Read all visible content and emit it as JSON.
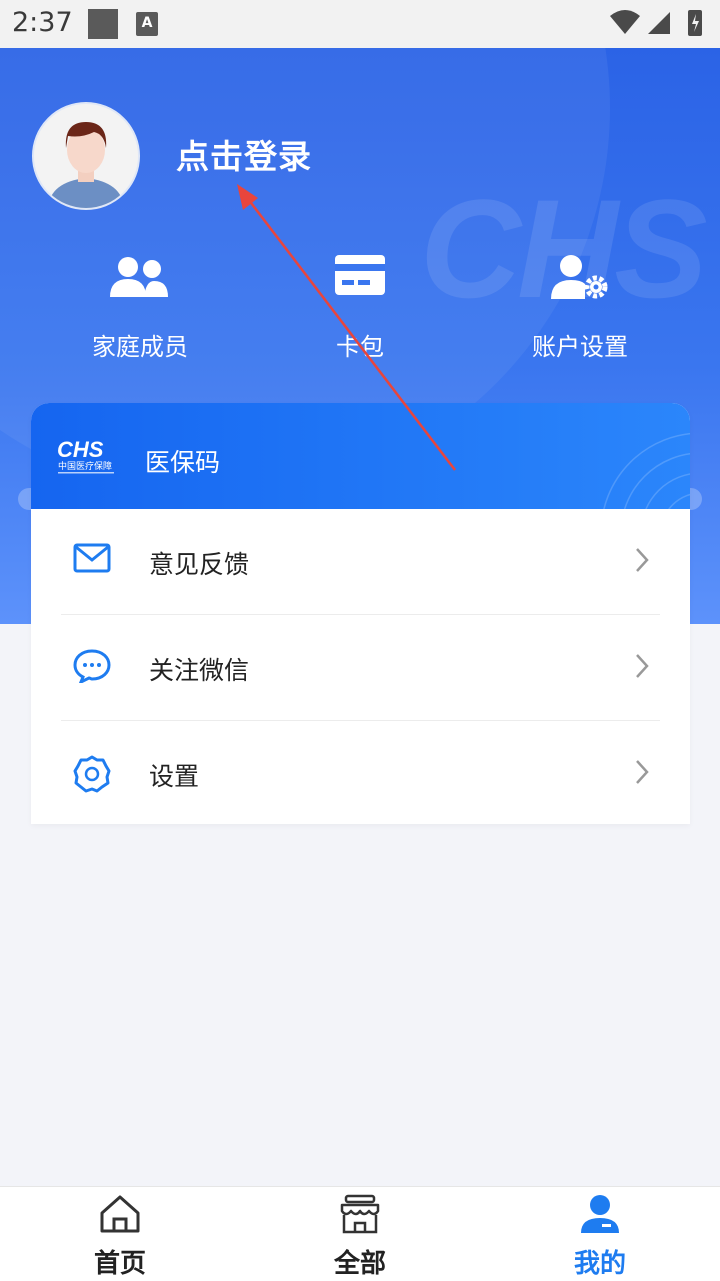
{
  "status_bar": {
    "time": "2:37"
  },
  "header": {
    "login_label": "点击登录"
  },
  "quick_actions": [
    {
      "label": "家庭成员",
      "icon": "users-icon"
    },
    {
      "label": "卡包",
      "icon": "card-icon"
    },
    {
      "label": "账户设置",
      "icon": "user-settings-icon"
    }
  ],
  "medical_code": {
    "logo_text": "CHS",
    "logo_subtitle": "中国医疗保障",
    "title": "医保码"
  },
  "menu": [
    {
      "label": "意见反馈",
      "icon": "mail-icon"
    },
    {
      "label": "关注微信",
      "icon": "chat-icon"
    },
    {
      "label": "设置",
      "icon": "gear-icon"
    }
  ],
  "tabbar": [
    {
      "label": "首页",
      "icon": "home-icon",
      "active": false
    },
    {
      "label": "全部",
      "icon": "store-icon",
      "active": false
    },
    {
      "label": "我的",
      "icon": "profile-icon",
      "active": true
    }
  ],
  "colors": {
    "primary": "#1e7cf0",
    "hero": "#2b63e6"
  }
}
